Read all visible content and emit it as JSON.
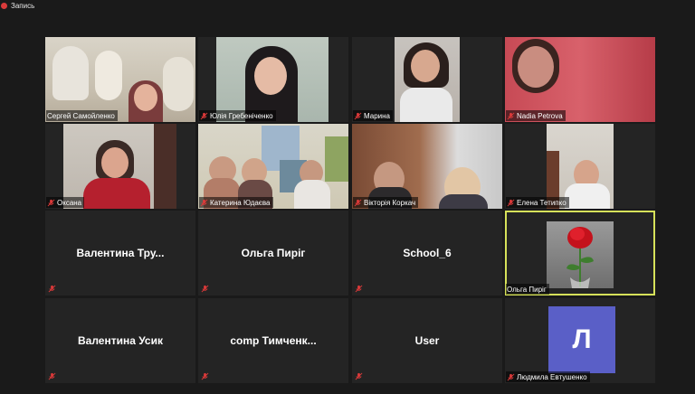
{
  "recording": {
    "label": "Запись"
  },
  "participants": [
    {
      "name": "Сергей Самойленко"
    },
    {
      "name": "Юлія Гребеніченко"
    },
    {
      "name": "Марина"
    },
    {
      "name": "Nadia Petrova"
    },
    {
      "name": "Оксана"
    },
    {
      "name": "Катерина Юдаєва"
    },
    {
      "name": "Вікторія Коркач"
    },
    {
      "name": "Елена Тетипко"
    },
    {
      "name": "Валентина Тру...",
      "display": "Валентина  Тру..."
    },
    {
      "name": "Ольга Пиріг",
      "display": "Ольга Пиріг"
    },
    {
      "name": "School_6",
      "display": "School_6"
    },
    {
      "name": "Ольга Пиріг",
      "active": true
    },
    {
      "name": "Валентина Усик",
      "display": "Валентина Усик"
    },
    {
      "name": "comp Тимченк...",
      "display": "comp  Тимченк..."
    },
    {
      "name": "User",
      "display": "User"
    },
    {
      "name": "Людмила Евтушенко",
      "avatar_letter": "Л"
    }
  ],
  "colors": {
    "active_border": "#d6e15a",
    "avatar_bg": "#5a5fc7",
    "mic_muted": "#e03a3a"
  }
}
